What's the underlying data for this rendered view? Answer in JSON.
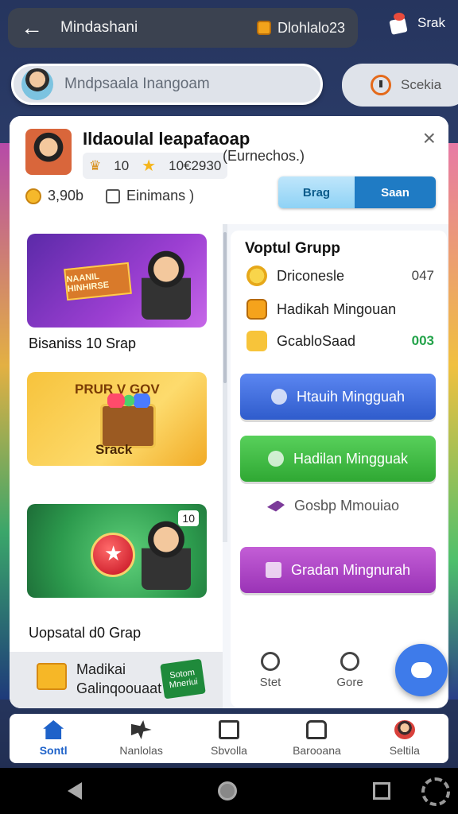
{
  "topbar": {
    "app_title": "Mindashani",
    "coin_value": "Dlohlalo23",
    "right_label": "Srak"
  },
  "search": {
    "placeholder": "Mndpsaala Inangoam",
    "side_pill_label": "Scekia"
  },
  "card": {
    "title": "Ildaoulal leapafaoap",
    "subtitle": "(Eurnechos.)",
    "badge_count": "10",
    "badge_score": "10€2930",
    "coins": "3,90b",
    "lock_label": "Einimans )",
    "seg_a": "Brag",
    "seg_b": "Saan",
    "close": "×"
  },
  "promos": [
    {
      "banner": "NAANIL HINHIRSE",
      "caption": "Bisaniss 10 Srap"
    },
    {
      "title": "PRUR V GOV",
      "label": "Srack"
    },
    {
      "tag": "10",
      "caption": "Uopsatal d0 Grap"
    }
  ],
  "footer_promo": {
    "line1": "Madikai",
    "line2": "Galinqoouaat",
    "stamp": "Sotom Mneriui"
  },
  "right_panel": {
    "heading": "Voptul Grupp",
    "items": [
      {
        "label": "Driconesle",
        "value": "047"
      },
      {
        "label": "Hadikah Mingouan",
        "value": ""
      },
      {
        "label": "GcabloSaad",
        "value": "003"
      }
    ],
    "btn1": "Htauih Mingguah",
    "btn2": "Hadilan Mingguak",
    "link": "Gosbp Mmouiao",
    "btn3": "Gradan Mingnurah",
    "foot1": "Stet",
    "foot2": "Gore"
  },
  "bottom_nav": [
    {
      "label": "Sontl",
      "icon": "home-icon"
    },
    {
      "label": "Nanlolas",
      "icon": "game-icon"
    },
    {
      "label": "Sbvolla",
      "icon": "ticket-icon"
    },
    {
      "label": "Barooana",
      "icon": "shop-icon"
    },
    {
      "label": "Seltila",
      "icon": "profile-icon"
    }
  ],
  "colors": {
    "accent": "#1e62c9",
    "blue_button": "#3f70e0",
    "green_button": "#3dbb3f",
    "purple_button": "#ae45c6"
  }
}
